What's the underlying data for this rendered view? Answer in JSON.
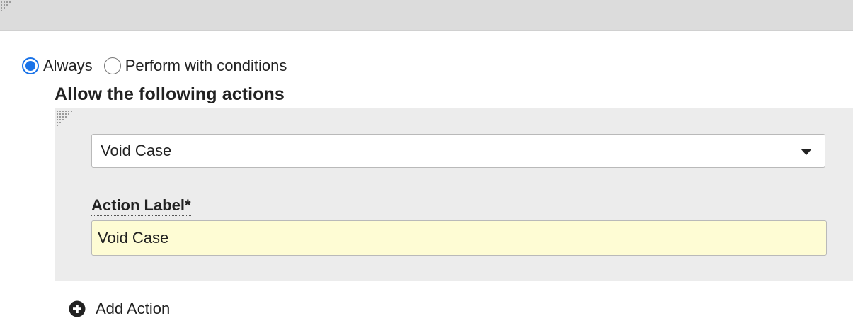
{
  "condition_mode": {
    "options": [
      {
        "label": "Always",
        "selected": true
      },
      {
        "label": "Perform with conditions",
        "selected": false
      }
    ]
  },
  "actions_section": {
    "title": "Allow the following actions",
    "action_type": {
      "value": "Void Case",
      "icon": "caret-down-icon"
    },
    "action_label": {
      "label": "Action Label*",
      "value": "Void Case"
    }
  },
  "add_action": {
    "label": "Add Action",
    "icon": "plus-circle-icon"
  },
  "colors": {
    "radio_accent": "#1a73e8",
    "input_highlight": "#fefcd4",
    "panel_bg": "#ececec"
  }
}
